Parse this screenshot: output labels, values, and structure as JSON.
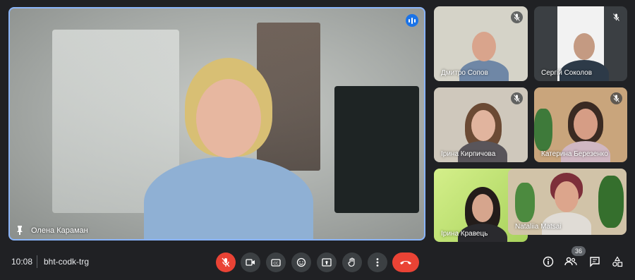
{
  "main_speaker": {
    "name": "Олена Караман"
  },
  "participants": [
    {
      "name": "Дмитро Сопов"
    },
    {
      "name": "Сергій Соколов"
    },
    {
      "name": "Ірина Кирпичова"
    },
    {
      "name": "Катерина Березенко"
    },
    {
      "name": "Ірина Кравець"
    },
    {
      "name": "Nataliia Matsai"
    }
  ],
  "bottom_bar": {
    "time": "10:08",
    "meeting_code": "bht-codk-trg",
    "participant_count": "36"
  },
  "colors": {
    "background": "#202124",
    "accent_blue": "#1a73e8",
    "active_border": "#8ab4f8",
    "danger_red": "#ea4335",
    "button_gray": "#3c4043"
  },
  "icons": [
    "pin-icon",
    "speaking-icon",
    "mic-muted-icon",
    "camera-icon",
    "captions-icon",
    "emoji-icon",
    "present-icon",
    "raise-hand-icon",
    "more-options-icon",
    "end-call-icon",
    "info-icon",
    "people-icon",
    "chat-icon",
    "activities-icon"
  ]
}
